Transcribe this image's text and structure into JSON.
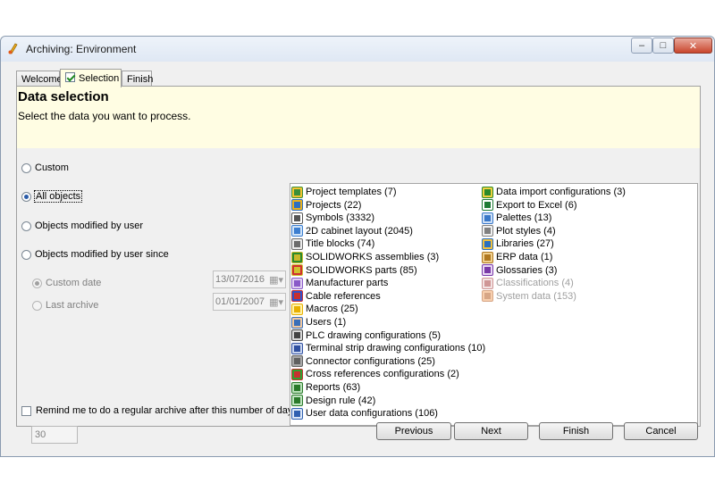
{
  "window": {
    "title": "Archiving: Environment",
    "controls": {
      "minimize": "–",
      "maximize": "□",
      "close": "✕"
    }
  },
  "tabs": [
    {
      "label": "Welcome",
      "active": false
    },
    {
      "label": "Selection",
      "active": true
    },
    {
      "label": "Finish",
      "active": false
    }
  ],
  "header": {
    "title": "Data selection",
    "subtitle": "Select the data you want to process."
  },
  "options": {
    "custom": "Custom",
    "all_objects": "All objects",
    "modified_by_user": "Objects modified by user",
    "modified_since": "Objects modified by user since",
    "custom_date": "Custom date",
    "last_archive": "Last archive",
    "custom_date_value": "13/07/2016",
    "last_archive_value": "01/01/2007",
    "reminder": "Remind me to do a regular archive after this number of days:",
    "reminder_days": "30"
  },
  "data_list": {
    "left_column": [
      {
        "label": "Project templates (7)",
        "icon": "project-templates-icon"
      },
      {
        "label": "Projects (22)",
        "icon": "projects-icon"
      },
      {
        "label": "Symbols (3332)",
        "icon": "symbols-icon"
      },
      {
        "label": "2D cabinet layout (2045)",
        "icon": "cabinet-layout-icon"
      },
      {
        "label": "Title blocks (74)",
        "icon": "title-blocks-icon"
      },
      {
        "label": "SOLIDWORKS assemblies (3)",
        "icon": "solidworks-assembly-icon"
      },
      {
        "label": "SOLIDWORKS parts (85)",
        "icon": "solidworks-part-icon"
      },
      {
        "label": "Manufacturer parts",
        "icon": "manufacturer-parts-icon"
      },
      {
        "label": "Cable references",
        "icon": "cable-references-icon"
      },
      {
        "label": "Macros (25)",
        "icon": "macros-star-icon"
      },
      {
        "label": "Users (1)",
        "icon": "users-icon"
      },
      {
        "label": "PLC drawing configurations (5)",
        "icon": "plc-config-icon"
      },
      {
        "label": "Terminal strip drawing configurations (10)",
        "icon": "terminal-strip-icon"
      },
      {
        "label": "Connector configurations (25)",
        "icon": "connector-icon"
      },
      {
        "label": "Cross references configurations (2)",
        "icon": "cross-references-icon"
      },
      {
        "label": "Reports (63)",
        "icon": "reports-icon"
      },
      {
        "label": "Design rule (42)",
        "icon": "design-rule-icon"
      },
      {
        "label": "User data configurations (106)",
        "icon": "user-data-icon"
      }
    ],
    "right_column": [
      {
        "label": "Data import configurations (3)",
        "icon": "data-import-icon",
        "enabled": true
      },
      {
        "label": "Export to Excel (6)",
        "icon": "excel-export-icon",
        "enabled": true
      },
      {
        "label": "Palettes (13)",
        "icon": "palettes-icon",
        "enabled": true
      },
      {
        "label": "Plot styles (4)",
        "icon": "plot-styles-icon",
        "enabled": true
      },
      {
        "label": "Libraries (27)",
        "icon": "libraries-icon",
        "enabled": true
      },
      {
        "label": "ERP data (1)",
        "icon": "erp-data-icon",
        "enabled": true
      },
      {
        "label": "Glossaries (3)",
        "icon": "glossaries-icon",
        "enabled": true
      },
      {
        "label": "Classifications (4)",
        "icon": "classifications-icon",
        "enabled": false
      },
      {
        "label": "System data (153)",
        "icon": "system-data-icon",
        "enabled": false
      }
    ]
  },
  "buttons": {
    "previous": "Previous",
    "next": "Next",
    "finish": "Finish",
    "cancel": "Cancel"
  }
}
